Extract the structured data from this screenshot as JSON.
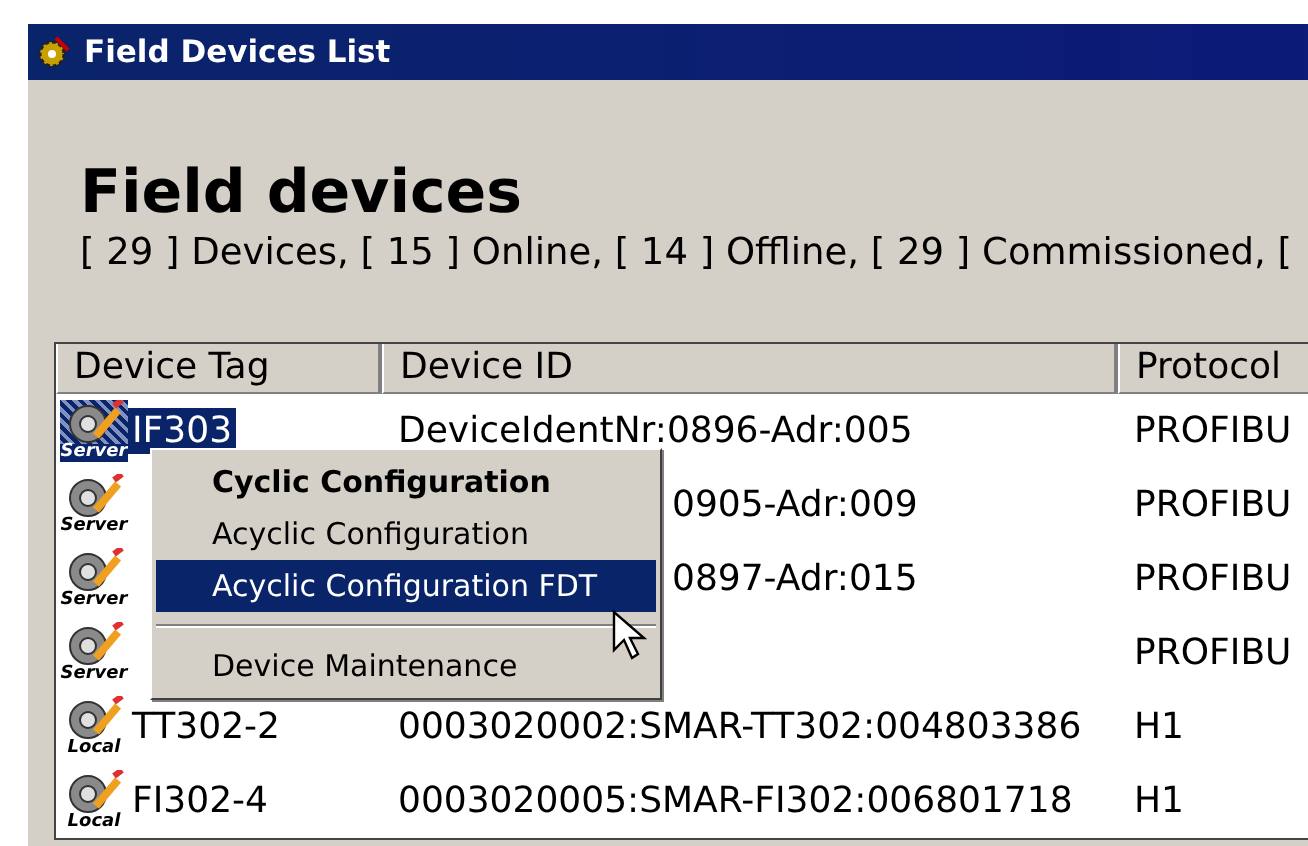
{
  "window": {
    "title": "Field Devices List"
  },
  "heading": "Field devices",
  "summary": "[ 29 ] Devices, [ 15 ] Online, [ 14 ] Offline, [ 29 ] Commissioned, [",
  "table": {
    "columns": [
      "Device Tag",
      "Device ID",
      "Protocol"
    ],
    "rows": [
      {
        "icon_label": "Server",
        "tag": "IF303",
        "device_id": "DeviceIdentNr:0896-Adr:005",
        "protocol": "PROFIBU",
        "selected": true
      },
      {
        "icon_label": "Server",
        "device_id": "0905-Adr:009",
        "protocol": "PROFIBU",
        "selected": false
      },
      {
        "icon_label": "Server",
        "device_id": "0897-Adr:015",
        "protocol": "PROFIBU",
        "selected": false
      },
      {
        "icon_label": "Server",
        "protocol": "PROFIBU",
        "selected": false
      },
      {
        "icon_label": "Local",
        "tag": "TT302-2",
        "device_id": "0003020002:SMAR-TT302:004803386",
        "protocol": "H1",
        "selected": false
      },
      {
        "icon_label": "Local",
        "tag": "FI302-4",
        "device_id": "0003020005:SMAR-FI302:006801718",
        "protocol": "H1",
        "selected": false
      }
    ]
  },
  "context_menu": {
    "items": [
      {
        "kind": "item",
        "label": "Cyclic Configuration",
        "default": true,
        "selected": false
      },
      {
        "kind": "item",
        "label": "Acyclic Configuration",
        "default": false,
        "selected": false
      },
      {
        "kind": "item",
        "label": "Acyclic Configuration FDT",
        "default": false,
        "selected": true
      },
      {
        "kind": "separator"
      },
      {
        "kind": "item",
        "label": "Device Maintenance",
        "default": false,
        "selected": false
      }
    ]
  }
}
